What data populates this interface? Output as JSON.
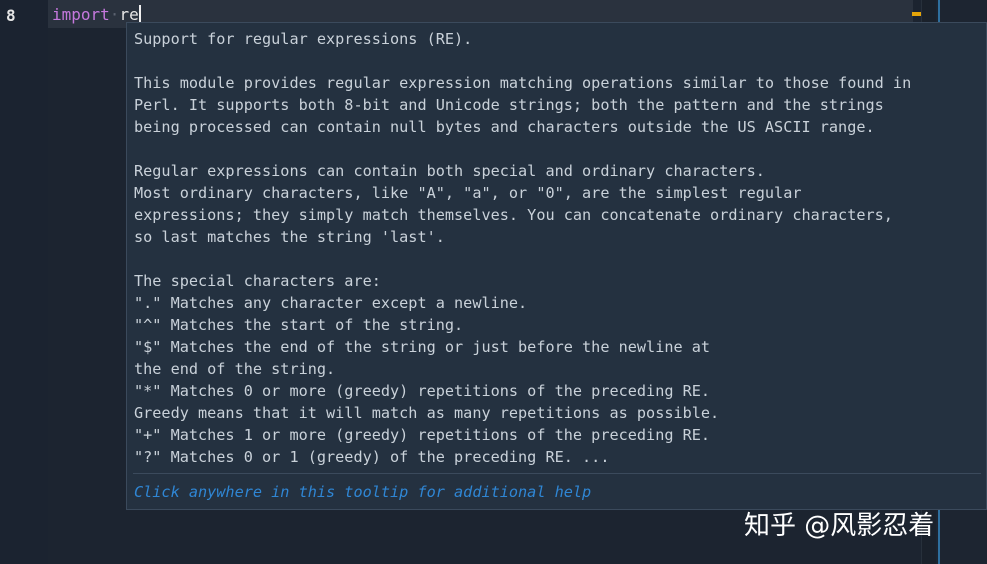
{
  "editor": {
    "line_number": "8",
    "keyword": "import",
    "whitespace_marker": "·",
    "module_name": "re"
  },
  "tooltip": {
    "lines": [
      "Support for regular expressions (RE).",
      "",
      "This module provides regular expression matching operations similar to those found in",
      "Perl. It supports both 8-bit and Unicode strings; both the pattern and the strings",
      "being processed can contain null bytes and characters outside the US ASCII range.",
      "",
      "Regular expressions can contain both special and ordinary characters.",
      "Most ordinary characters, like \"A\", \"a\", or \"0\", are the simplest regular",
      "expressions; they simply match themselves. You can concatenate ordinary characters,",
      "so last matches the string 'last'.",
      "",
      "The special characters are:",
      "\".\" Matches any character except a newline.",
      "\"^\" Matches the start of the string.",
      "\"$\" Matches the end of the string or just before the newline at",
      "the end of the string.",
      "\"*\" Matches 0 or more (greedy) repetitions of the preceding RE.",
      "Greedy means that it will match as many repetitions as possible.",
      "\"+\" Matches 1 or more (greedy) repetitions of the preceding RE.",
      "\"?\" Matches 0 or 1 (greedy) of the preceding RE. ..."
    ],
    "footer_link": "Click anywhere in this tooltip for additional help"
  },
  "watermark": "知乎 @风影忍着",
  "colors": {
    "background": "#1c2430",
    "keyword": "#c678dd",
    "tooltip_bg": "#243140",
    "link": "#2f86d4",
    "scroll_marker": "#e5a50a"
  }
}
